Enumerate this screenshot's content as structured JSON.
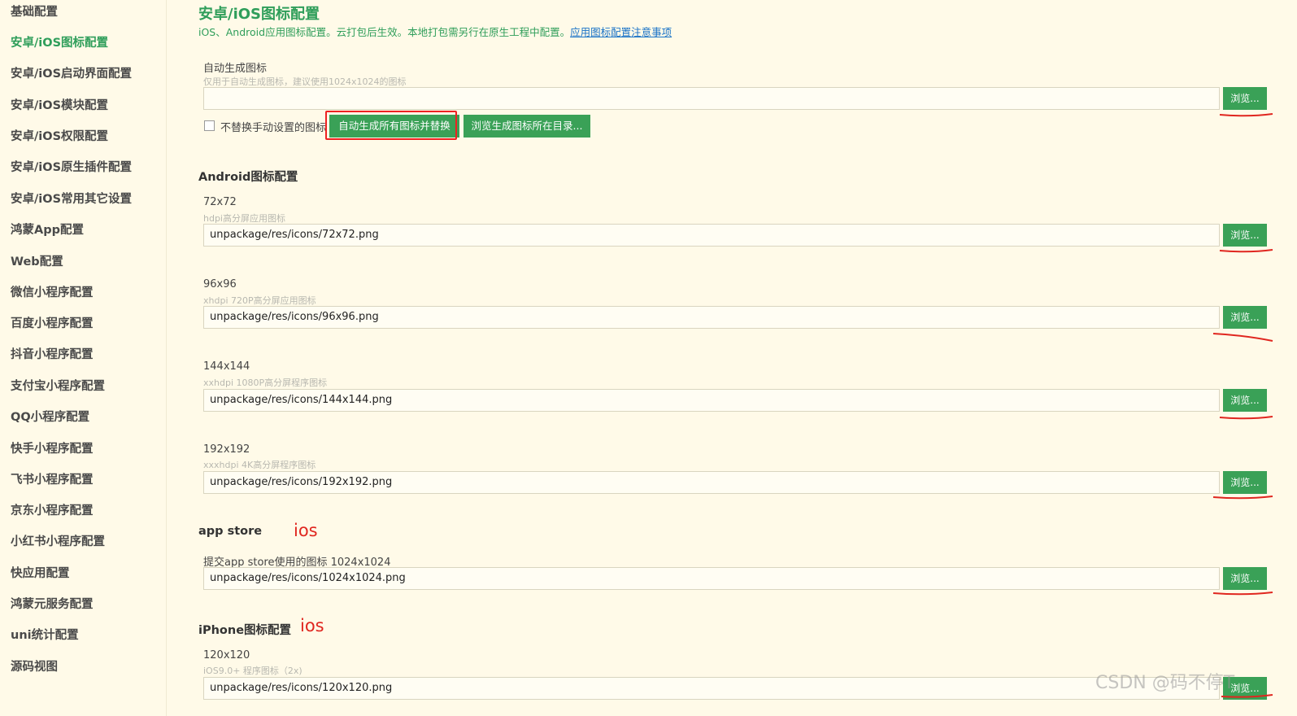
{
  "sidebar": {
    "items": [
      {
        "label": "基础配置"
      },
      {
        "label": "安卓/iOS图标配置"
      },
      {
        "label": "安卓/iOS启动界面配置"
      },
      {
        "label": "安卓/iOS模块配置"
      },
      {
        "label": "安卓/iOS权限配置"
      },
      {
        "label": "安卓/iOS原生插件配置"
      },
      {
        "label": "安卓/iOS常用其它设置"
      },
      {
        "label": "鸿蒙App配置"
      },
      {
        "label": "Web配置"
      },
      {
        "label": "微信小程序配置"
      },
      {
        "label": "百度小程序配置"
      },
      {
        "label": "抖音小程序配置"
      },
      {
        "label": "支付宝小程序配置"
      },
      {
        "label": "QQ小程序配置"
      },
      {
        "label": "快手小程序配置"
      },
      {
        "label": "飞书小程序配置"
      },
      {
        "label": "京东小程序配置"
      },
      {
        "label": "小红书小程序配置"
      },
      {
        "label": "快应用配置"
      },
      {
        "label": "鸿蒙元服务配置"
      },
      {
        "label": "uni统计配置"
      },
      {
        "label": "源码视图"
      }
    ],
    "active_index": 1
  },
  "page": {
    "title": "安卓/iOS图标配置",
    "description": "iOS、Android应用图标配置。云打包后生效。本地打包需另行在原生工程中配置。",
    "description_link": "应用图标配置注意事项"
  },
  "auto": {
    "label": "自动生成图标",
    "hint": "仅用于自动生成图标，建议使用1024x1024的图标",
    "value": "",
    "checkbox_label": "不替换手动设置的图标",
    "checkbox_checked": false,
    "generate_button": "自动生成所有图标并替换",
    "open_dir_button": "浏览生成图标所在目录..."
  },
  "browse_label": "浏览...",
  "android": {
    "section_title": "Android图标配置",
    "fields": [
      {
        "label": "72x72",
        "hint": "hdpi高分屏应用图标",
        "value": "unpackage/res/icons/72x72.png"
      },
      {
        "label": "96x96",
        "hint": "xhdpi 720P高分屏应用图标",
        "value": "unpackage/res/icons/96x96.png"
      },
      {
        "label": "144x144",
        "hint": "xxhdpi 1080P高分屏程序图标",
        "value": "unpackage/res/icons/144x144.png"
      },
      {
        "label": "192x192",
        "hint": "xxxhdpi 4K高分屏程序图标",
        "value": "unpackage/res/icons/192x192.png"
      }
    ]
  },
  "appstore": {
    "section_title": "app store",
    "annotation": "ios",
    "label": "提交app store使用的图标 1024x1024",
    "value": "unpackage/res/icons/1024x1024.png"
  },
  "iphone": {
    "section_title": "iPhone图标配置",
    "annotation": "ios",
    "fields": [
      {
        "label": "120x120",
        "hint": "iOS9.0+ 程序图标（2x)",
        "value": "unpackage/res/icons/120x120.png"
      }
    ]
  },
  "watermark": "CSDN @码不停T",
  "colors": {
    "background": "#fffae8",
    "accent": "#2f9e5a",
    "button": "#3aa157",
    "link": "#1a73c7",
    "annotation": "#e0261f"
  }
}
